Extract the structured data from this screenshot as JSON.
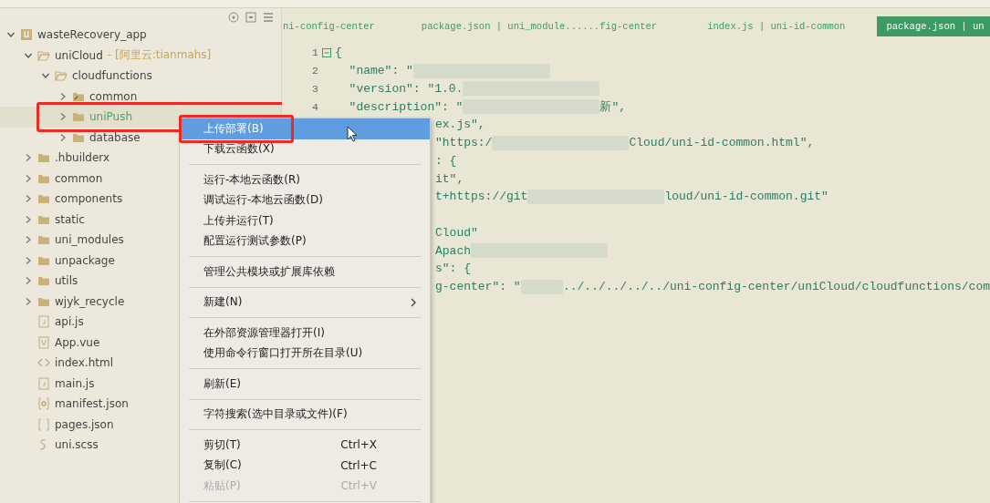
{
  "sidebar": {
    "tree": [
      {
        "label": "wasteRecovery_app",
        "kind": "project",
        "expanded": true,
        "children": [
          {
            "label": "uniCloud",
            "note": "- [阿里云:tianmahs]",
            "kind": "openfolder",
            "expanded": true,
            "children": [
              {
                "label": "cloudfunctions",
                "kind": "openfolder",
                "expanded": true,
                "children": [
                  {
                    "label": "common",
                    "kind": "linkfolder",
                    "expanded": false
                  },
                  {
                    "label": "uniPush",
                    "kind": "folder",
                    "expanded": false,
                    "hovered": true,
                    "annotated": true
                  },
                  {
                    "label": "database",
                    "kind": "folder",
                    "expanded": false
                  }
                ]
              }
            ]
          },
          {
            "label": ".hbuilderx",
            "kind": "folder",
            "expanded": false
          },
          {
            "label": "common",
            "kind": "folder",
            "expanded": false
          },
          {
            "label": "components",
            "kind": "folder",
            "expanded": false
          },
          {
            "label": "static",
            "kind": "folder",
            "expanded": false
          },
          {
            "label": "uni_modules",
            "kind": "folder",
            "expanded": false
          },
          {
            "label": "unpackage",
            "kind": "folder",
            "expanded": false
          },
          {
            "label": "utils",
            "kind": "folder",
            "expanded": false
          },
          {
            "label": "wjyk_recycle",
            "kind": "folder",
            "expanded": false
          },
          {
            "label": "api.js",
            "kind": "js"
          },
          {
            "label": "App.vue",
            "kind": "vue"
          },
          {
            "label": "index.html",
            "kind": "html"
          },
          {
            "label": "main.js",
            "kind": "js"
          },
          {
            "label": "manifest.json",
            "kind": "manifest"
          },
          {
            "label": "pages.json",
            "kind": "brackets"
          },
          {
            "label": "uni.scss",
            "kind": "scss"
          }
        ]
      }
    ]
  },
  "tabs": [
    {
      "label": "ni-config-center",
      "selected": false
    },
    {
      "label": "package.json | uni_module......fig-center",
      "selected": false
    },
    {
      "label": "index.js | uni-id-common",
      "selected": false
    },
    {
      "label": "package.json | un",
      "selected": true
    }
  ],
  "editor": {
    "lines": [
      {
        "number": "1",
        "segments": [
          {
            "kind": "text",
            "text": "{"
          }
        ]
      },
      {
        "number": "2",
        "segments": [
          {
            "kind": "text",
            "text": "  \"name\": \""
          },
          {
            "kind": "blur"
          }
        ]
      },
      {
        "number": "3",
        "segments": [
          {
            "kind": "text",
            "text": "  \"version\": \"1.0."
          },
          {
            "kind": "blur"
          }
        ]
      },
      {
        "number": "4",
        "segments": [
          {
            "kind": "text",
            "text": "  \"description\": \""
          },
          {
            "kind": "blur"
          },
          {
            "kind": "text",
            "text": "新\","
          }
        ]
      },
      {
        "segments": [
          {
            "kind": "text",
            "text": "ex.js\","
          }
        ]
      },
      {
        "segments": [
          {
            "kind": "text",
            "text": "\"https:/"
          },
          {
            "kind": "blur"
          },
          {
            "kind": "text",
            "text": "Cloud/uni-id-common.html\","
          }
        ]
      },
      {
        "segments": [
          {
            "kind": "text",
            "text": ": {"
          }
        ]
      },
      {
        "segments": [
          {
            "kind": "text",
            "text": "it\","
          }
        ]
      },
      {
        "segments": [
          {
            "kind": "text",
            "text": "t+https://git"
          },
          {
            "kind": "blur"
          },
          {
            "kind": "text",
            "text": "loud/uni-id-common.git\""
          }
        ]
      },
      {
        "kind": "blank"
      },
      {
        "segments": [
          {
            "kind": "text",
            "text": "Cloud\""
          }
        ]
      },
      {
        "segments": [
          {
            "kind": "text",
            "text": "Apach"
          },
          {
            "kind": "blur"
          }
        ]
      },
      {
        "segments": [
          {
            "kind": "text",
            "text": "s\": {"
          }
        ]
      },
      {
        "segments": [
          {
            "kind": "text",
            "text": "g-center\": \""
          },
          {
            "kind": "blur"
          },
          {
            "kind": "text",
            "text": "../../../../../uni-config-center/uniCloud/cloudfunctions/com"
          }
        ]
      }
    ]
  },
  "context_menu": {
    "items": [
      {
        "kind": "item",
        "label": "上传部署(B)",
        "selected": true,
        "annotated": true
      },
      {
        "kind": "item",
        "label": "下载云函数(X)",
        "selected": false
      },
      {
        "kind": "separator"
      },
      {
        "kind": "item",
        "label": "运行-本地云函数(R)",
        "selected": false
      },
      {
        "kind": "item",
        "label": "调试运行-本地云函数(D)",
        "selected": false
      },
      {
        "kind": "item",
        "label": "上传并运行(T)",
        "selected": false
      },
      {
        "kind": "item",
        "label": "配置运行测试参数(P)",
        "selected": false
      },
      {
        "kind": "separator"
      },
      {
        "kind": "item",
        "label": "管理公共模块或扩展库依赖",
        "selected": false
      },
      {
        "kind": "separator"
      },
      {
        "kind": "item",
        "label": "新建(N)",
        "selected": false,
        "submenu": true
      },
      {
        "kind": "separator"
      },
      {
        "kind": "item",
        "label": "在外部资源管理器打开(I)",
        "selected": false
      },
      {
        "kind": "item",
        "label": "使用命令行窗口打开所在目录(U)",
        "selected": false
      },
      {
        "kind": "separator"
      },
      {
        "kind": "item",
        "label": "刷新(E)",
        "selected": false
      },
      {
        "kind": "separator"
      },
      {
        "kind": "item",
        "label": "字符搜索(选中目录或文件)(F)",
        "selected": false
      },
      {
        "kind": "separator"
      },
      {
        "kind": "item",
        "label": "剪切(T)",
        "shortcut": "Ctrl+X",
        "selected": false
      },
      {
        "kind": "item",
        "label": "复制(C)",
        "shortcut": "Ctrl+C",
        "selected": false
      },
      {
        "kind": "item",
        "label": "粘贴(P)",
        "shortcut": "Ctrl+V",
        "selected": false,
        "disabled": true
      },
      {
        "kind": "separator"
      }
    ]
  }
}
